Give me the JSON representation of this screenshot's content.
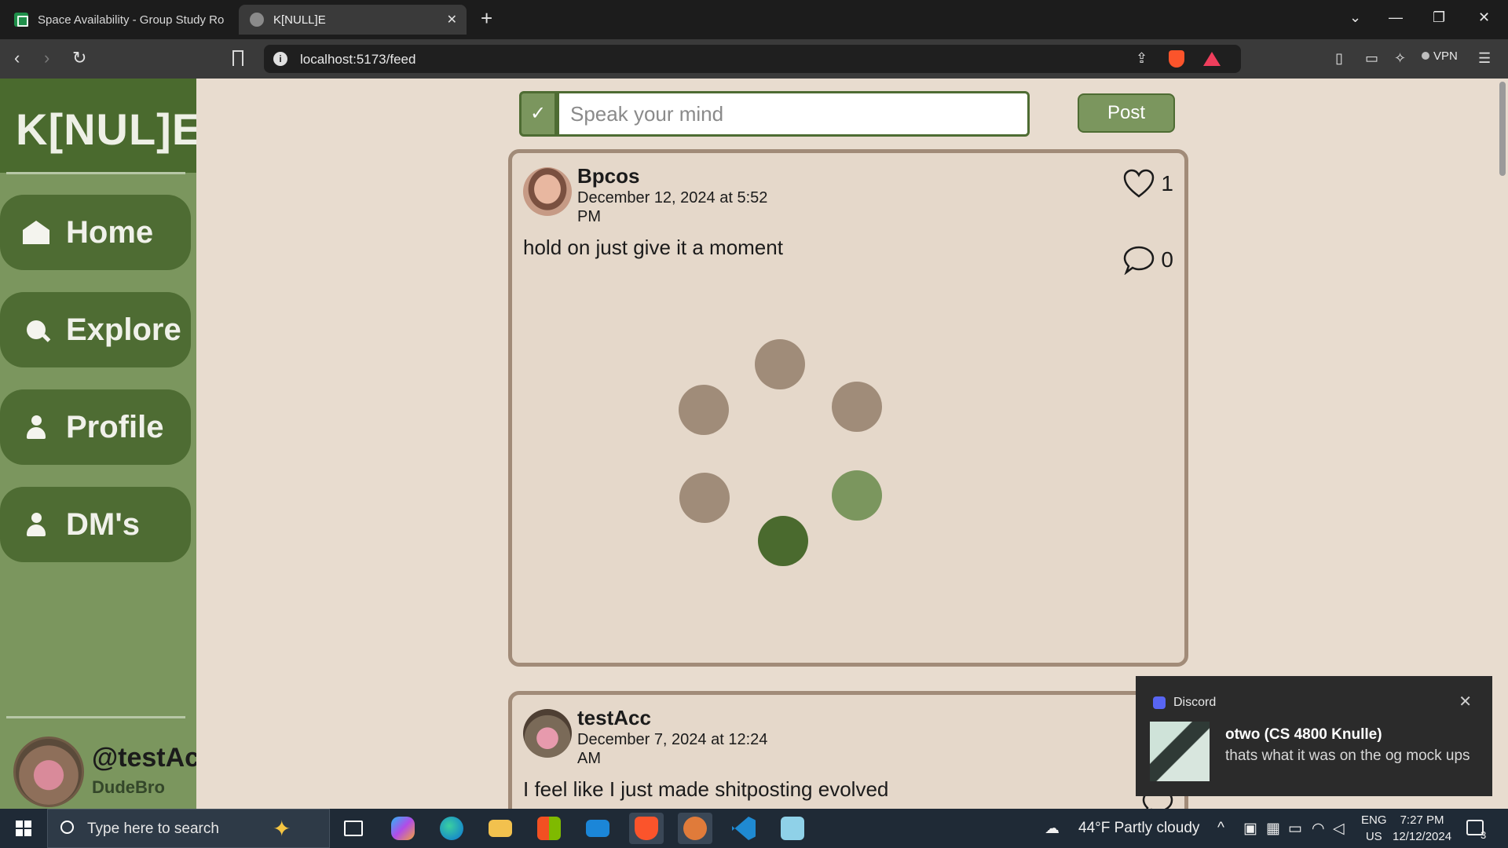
{
  "browser": {
    "tabs": [
      {
        "title": "Space Availability - Group Study Ro",
        "favicon": "sheets-icon"
      },
      {
        "title": "K[NULL]E",
        "favicon": "globe-icon"
      }
    ],
    "url": "localhost:5173/feed",
    "vpn_label": "VPN"
  },
  "sidebar": {
    "logo": "K[NUL]E",
    "items": [
      {
        "label": "Home",
        "icon": "home-icon"
      },
      {
        "label": "Explore",
        "icon": "search-icon"
      },
      {
        "label": "Profile",
        "icon": "person-icon"
      },
      {
        "label": "DM's",
        "icon": "person-icon"
      }
    ],
    "user": {
      "handle": "@testAcc",
      "display_name": "DudeBro"
    }
  },
  "composer": {
    "check": "✓",
    "placeholder": "Speak your mind",
    "post_label": "Post"
  },
  "posts": [
    {
      "author": "Bpcos",
      "date": "December 12, 2024 at 5:52 PM",
      "body": "hold on just give it a moment",
      "likes": "1",
      "comments": "0",
      "liked": false
    },
    {
      "author": "testAcc",
      "date": "December 7, 2024 at 12:24 AM",
      "body": "I feel like I just made shitposting evolved",
      "liked": true
    }
  ],
  "loader_colors": [
    "#a08c79",
    "#7b965e",
    "#4a6a2e"
  ],
  "toast": {
    "app": "Discord",
    "sender": "otwo (CS 4800 Knulle)",
    "message": "thats what it was on the og mock ups"
  },
  "taskbar": {
    "search_placeholder": "Type here to search",
    "weather": "44°F  Partly cloudy",
    "lang": "ENG",
    "region": "US",
    "time": "7:27 PM",
    "date": "12/12/2024",
    "notifications": "3"
  }
}
